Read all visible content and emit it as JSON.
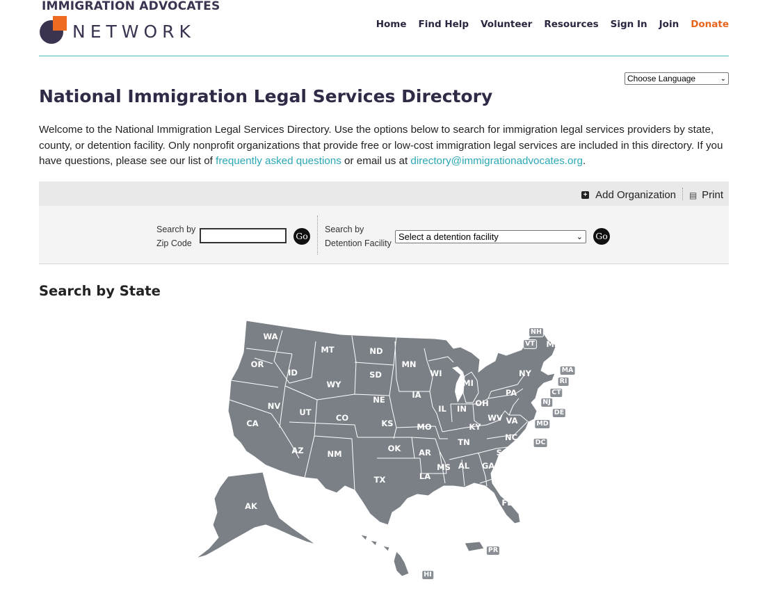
{
  "header": {
    "logo_top": "IMMIGRATION ADVOCATES",
    "logo_bottom": "NETWORK",
    "nav": {
      "home": "Home",
      "find_help": "Find Help",
      "volunteer": "Volunteer",
      "resources": "Resources",
      "sign_in": "Sign In",
      "join": "Join",
      "donate": "Donate"
    },
    "language_select": "Choose Language"
  },
  "main": {
    "title": "National Immigration Legal Services Directory",
    "intro_text": "Welcome to the National Immigration Legal Services Directory. Use the options below to search for immigration legal services providers by state, county, or detention facility. Only nonprofit organizations that provide free or low-cost immigration legal services are included in this directory. If you have questions, please see our list of ",
    "faq_link": "frequently asked questions",
    "intro_mid": " or email us at ",
    "email_link": "directory@immigrationadvocates.org",
    "intro_end": "."
  },
  "toolbar": {
    "add_org": "Add Organization",
    "print": "Print"
  },
  "search": {
    "zip_label_line1": "Search by",
    "zip_label_line2": "Zip Code",
    "zip_value": "",
    "go": "Go",
    "facility_label_line1": "Search by",
    "facility_label_line2": "Detention Facility",
    "facility_select": "Select a detention facility"
  },
  "state_section": {
    "title": "Search by State"
  },
  "colors": {
    "accent_teal": "#2ba8b6",
    "donate_orange": "#e8641c",
    "brand_purple": "#3b3350",
    "map_gray": "#7b8087"
  },
  "map": {
    "states": [
      "WA",
      "OR",
      "CA",
      "ID",
      "NV",
      "MT",
      "WY",
      "UT",
      "AZ",
      "CO",
      "NM",
      "ND",
      "SD",
      "NE",
      "KS",
      "OK",
      "TX",
      "MN",
      "IA",
      "MO",
      "AR",
      "LA",
      "WI",
      "IL",
      "MI",
      "IN",
      "OH",
      "KY",
      "TN",
      "MS",
      "AL",
      "GA",
      "FL",
      "SC",
      "NC",
      "VA",
      "WV",
      "PA",
      "NY",
      "ME",
      "NH",
      "VT",
      "MA",
      "RI",
      "CT",
      "NJ",
      "DE",
      "MD",
      "DC",
      "AK",
      "HI",
      "PR"
    ]
  }
}
